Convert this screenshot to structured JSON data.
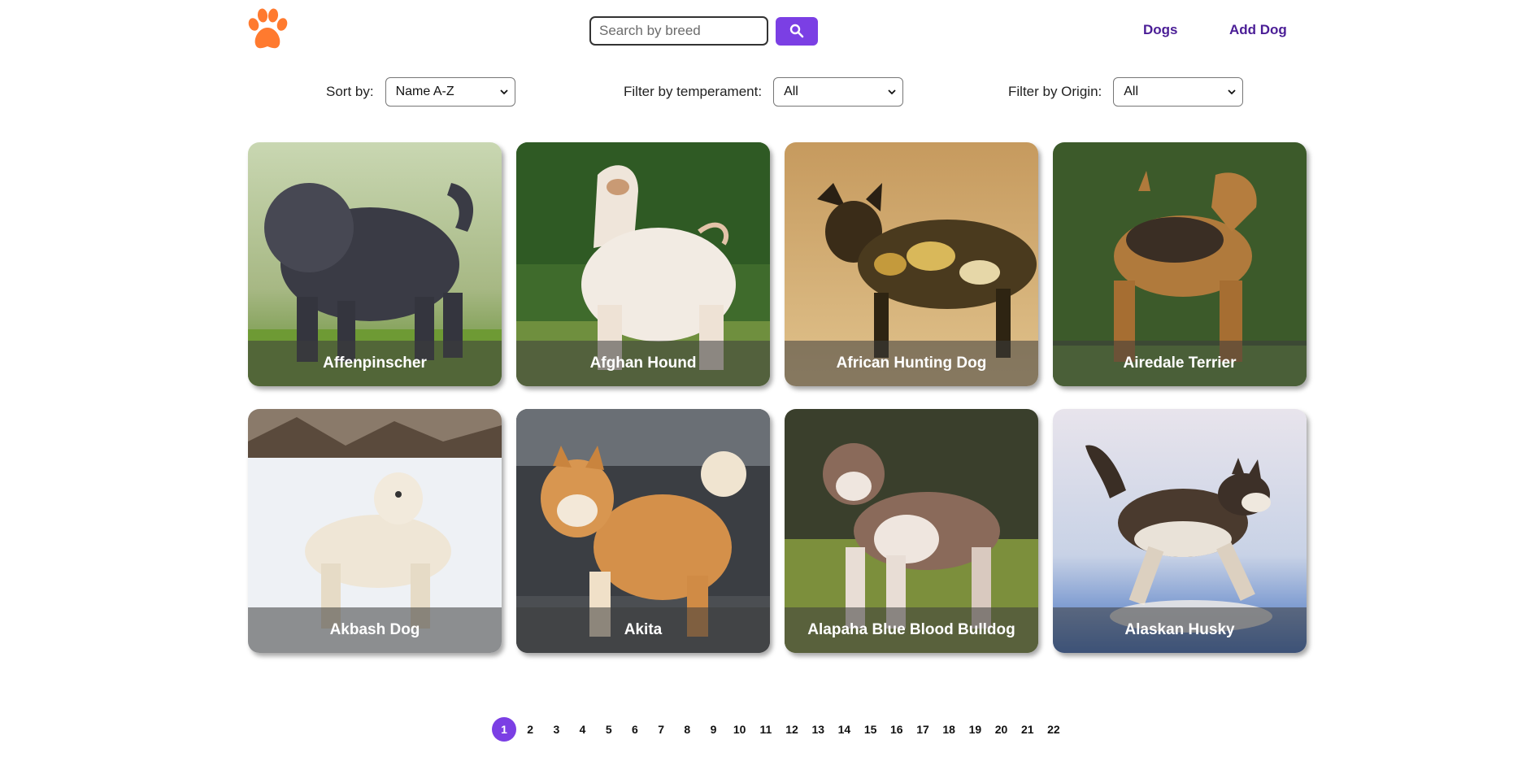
{
  "header": {
    "logo_icon": "paw-icon",
    "logo_color": "#ff7a2f",
    "search": {
      "placeholder": "Search by breed",
      "value": "",
      "button_icon": "search-icon"
    },
    "nav": {
      "dogs_label": "Dogs",
      "add_dog_label": "Add Dog"
    }
  },
  "filters": {
    "sort": {
      "label": "Sort by:",
      "selected": "Name A-Z"
    },
    "temperament": {
      "label": "Filter by temperament:",
      "selected": "All"
    },
    "origin": {
      "label": "Filter by Origin:",
      "selected": "All"
    }
  },
  "cards": [
    {
      "name": "Affenpinscher"
    },
    {
      "name": "Afghan Hound"
    },
    {
      "name": "African Hunting Dog"
    },
    {
      "name": "Airedale Terrier"
    },
    {
      "name": "Akbash Dog"
    },
    {
      "name": "Akita"
    },
    {
      "name": "Alapaha Blue Blood Bulldog"
    },
    {
      "name": "Alaskan Husky"
    }
  ],
  "pagination": {
    "current": "1",
    "pages": [
      "1",
      "2",
      "3",
      "4",
      "5",
      "6",
      "7",
      "8",
      "9",
      "10",
      "11",
      "12",
      "13",
      "14",
      "15",
      "16",
      "17",
      "18",
      "19",
      "20",
      "21",
      "22"
    ]
  },
  "colors": {
    "accent": "#7b3fe4",
    "nav_link": "#4a1d96"
  }
}
